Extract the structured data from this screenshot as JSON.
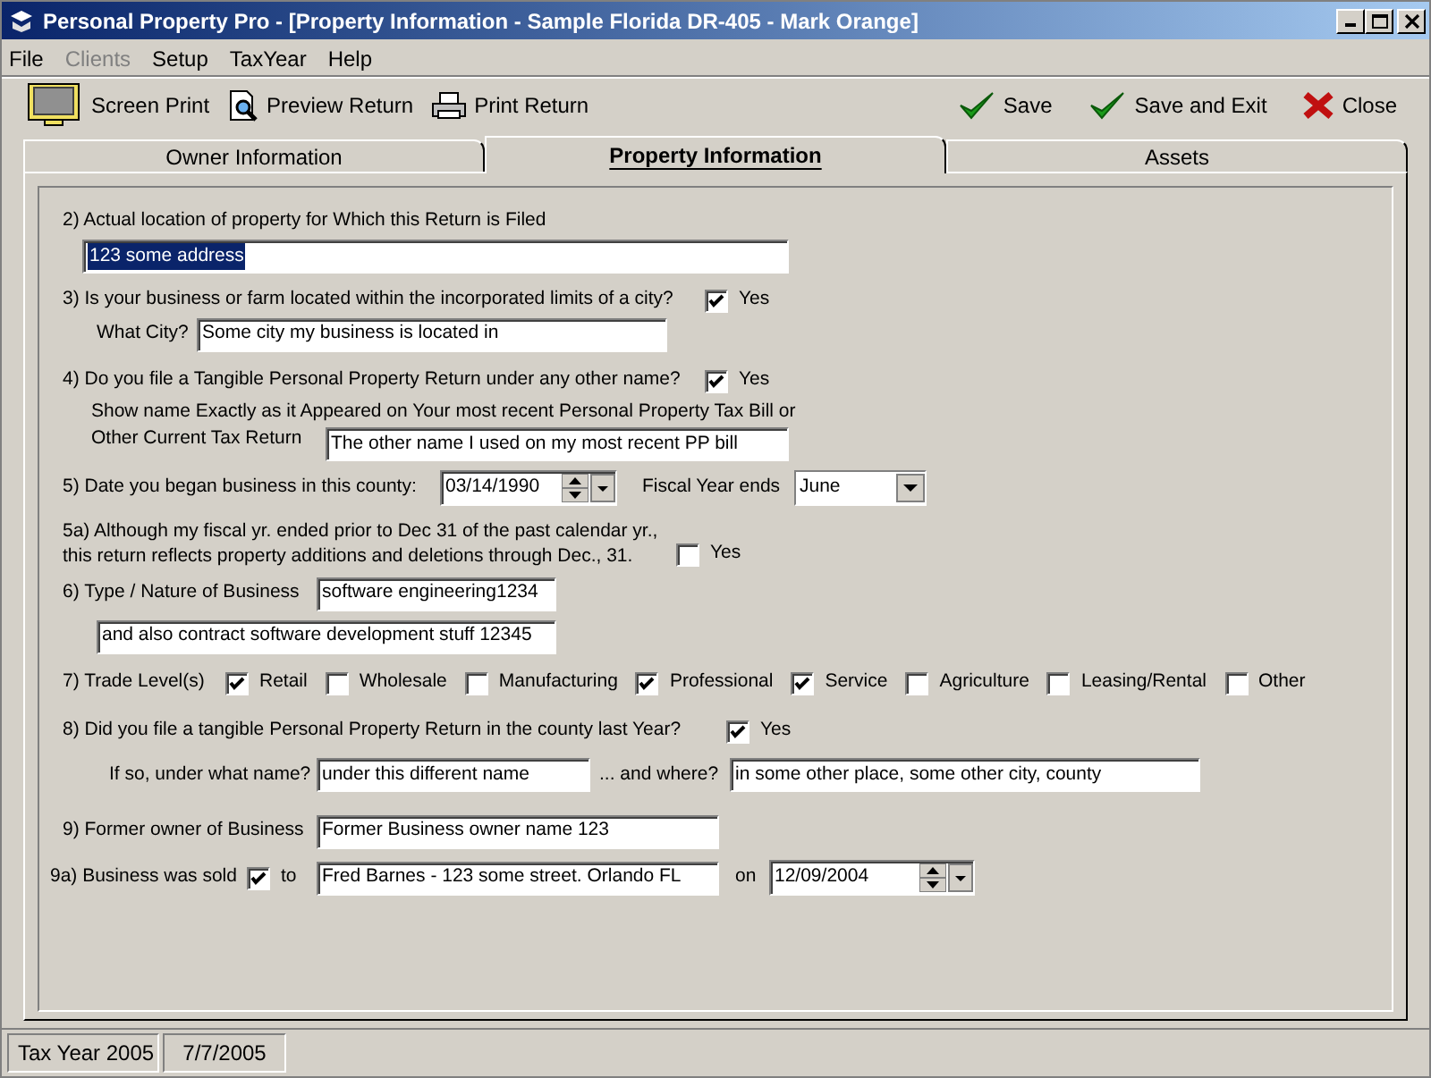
{
  "window": {
    "title": "Personal Property Pro - [Property Information - Sample Florida DR-405 - Mark Orange]"
  },
  "menu": [
    {
      "label": "File",
      "disabled": false
    },
    {
      "label": "Clients",
      "disabled": true
    },
    {
      "label": "Setup",
      "disabled": false
    },
    {
      "label": "TaxYear",
      "disabled": false
    },
    {
      "label": "Help",
      "disabled": false
    }
  ],
  "toolbar": {
    "left": [
      {
        "label": "Screen Print",
        "kind": "monitor"
      },
      {
        "label": "Preview Return",
        "kind": "preview"
      },
      {
        "label": "Print Return",
        "kind": "printer"
      }
    ],
    "right": [
      {
        "label": "Save",
        "kind": "check"
      },
      {
        "label": "Save and Exit",
        "kind": "check"
      },
      {
        "label": "Close",
        "kind": "cross"
      }
    ]
  },
  "tabs": [
    {
      "label": "Owner Information",
      "selected": false
    },
    {
      "label": "Property Information",
      "selected": true
    },
    {
      "label": "Assets",
      "selected": false
    }
  ],
  "q2": {
    "label": "2) Actual location of property for Which this Return is Filed",
    "field": {
      "value": "123 some address",
      "highlighted": true
    }
  },
  "q3": {
    "label": "3) Is your business or farm located within the incorporated limits of a city?",
    "checkbox": {
      "label": "Yes",
      "checked": true
    },
    "city_label": "What City?",
    "city": {
      "value": "Some city my business is located in"
    }
  },
  "q4": {
    "label": "4)  Do you file a Tangible Personal Property Return under any other name?",
    "checkbox": {
      "label": "Yes",
      "checked": true
    },
    "name_label_lines": [
      "Show name Exactly as it Appeared on Your most recent Personal Property Tax Bill or",
      "Other Current Tax Return"
    ],
    "name": {
      "value": "The other name I used on my most recent PP bill"
    }
  },
  "q5": {
    "label": "5) Date you began business in this county:",
    "date": "03/14/1990",
    "fiscal_label": "Fiscal Year ends",
    "fiscal_month": "June"
  },
  "q5a": {
    "label_lines": [
      "5a) Although my fiscal yr. ended prior to Dec 31 of the past calendar yr.,",
      "this return reflects property additions and deletions through Dec., 31."
    ],
    "checkbox": {
      "label": "Yes",
      "checked": false
    }
  },
  "q6": {
    "label": "6) Type / Nature of Business",
    "line1": {
      "value": "software engineering1234"
    },
    "line2": {
      "value": "and also contract software development stuff 12345"
    }
  },
  "q7": {
    "label": "7) Trade Level(s)",
    "options": [
      {
        "label": "Retail",
        "checked": true
      },
      {
        "label": "Wholesale",
        "checked": false
      },
      {
        "label": "Manufacturing",
        "checked": false
      },
      {
        "label": "Professional",
        "checked": true
      },
      {
        "label": "Service",
        "checked": true
      },
      {
        "label": "Agriculture",
        "checked": false
      },
      {
        "label": "Leasing/Rental",
        "checked": false
      },
      {
        "label": "Other",
        "checked": false
      }
    ]
  },
  "q8": {
    "label": "8) Did you file a tangible Personal Property Return in the county last Year?",
    "checkbox": {
      "label": "Yes",
      "checked": true
    },
    "name_label": "If so, under what name?",
    "name": {
      "value": "under this different name"
    },
    "where_label": "... and where?",
    "where": {
      "value": "in some other place, some other city, county"
    }
  },
  "q9": {
    "label": "9) Former owner of Business",
    "field": {
      "value": "Former Business owner name 123"
    }
  },
  "q9a": {
    "label": "9a) Business was sold",
    "sold": {
      "checked": true
    },
    "to_label": "to",
    "buyer": {
      "value": "Fred Barnes - 123 some street.  Orlando FL"
    },
    "on_label": "on",
    "date": "12/09/2004"
  },
  "status_bar": [
    "Tax Year 2005",
    "7/7/2005"
  ]
}
